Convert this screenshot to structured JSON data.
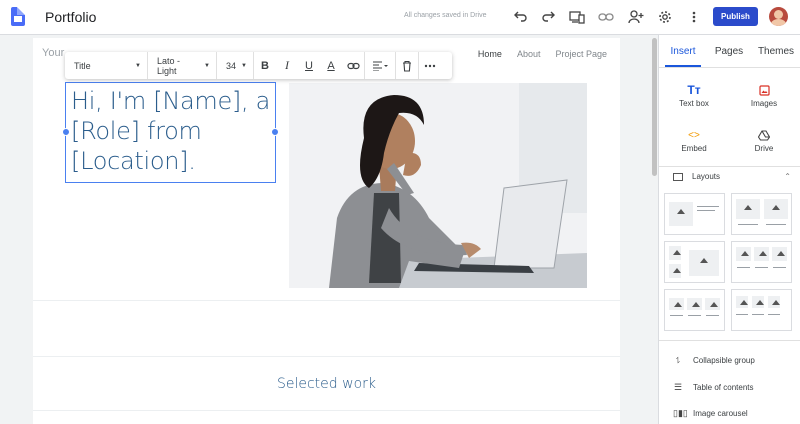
{
  "app": {
    "site_name": "Portfolio",
    "save_status": "All changes saved in Drive",
    "publish_label": "Publish",
    "accent": "#2b4bcb",
    "toolbar_icons": [
      "undo-icon",
      "redo-icon",
      "preview-device-icon",
      "copy-link-icon",
      "share-person-icon",
      "settings-gear-icon",
      "more-vert-icon"
    ]
  },
  "canvas": {
    "site_title_peek": "Your",
    "nav": [
      "Home",
      "About",
      "Project Page"
    ],
    "format_toolbar": {
      "style": "Title",
      "font": "Lato - Light",
      "size": "34"
    },
    "hero_lines": [
      "Hi, I'm [Name], a",
      "[Role] from",
      "[Location]."
    ],
    "section_heading": "Selected work",
    "text_color": "#2b5d8c"
  },
  "panel": {
    "tabs": [
      "Insert",
      "Pages",
      "Themes"
    ],
    "active_tab": "Insert",
    "insert_items": [
      {
        "label": "Text box",
        "icon": "text-box-icon"
      },
      {
        "label": "Images",
        "icon": "images-icon"
      },
      {
        "label": "Embed",
        "icon": "embed-icon"
      },
      {
        "label": "Drive",
        "icon": "drive-icon"
      }
    ],
    "layouts_label": "Layouts",
    "components": [
      {
        "label": "Collapsible group",
        "icon": "collapsible-group-icon"
      },
      {
        "label": "Table of contents",
        "icon": "table-of-contents-icon"
      },
      {
        "label": "Image carousel",
        "icon": "image-carousel-icon"
      }
    ]
  }
}
